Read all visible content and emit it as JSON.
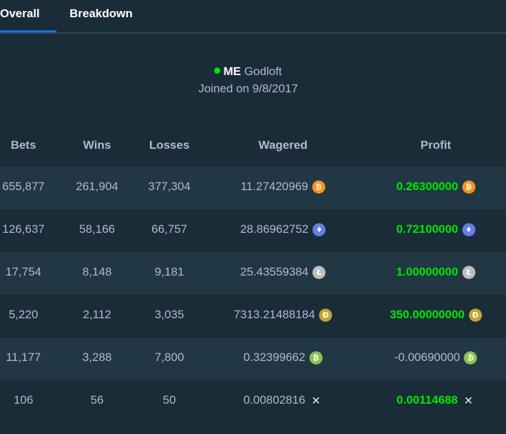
{
  "tabs": [
    {
      "label": "Overall",
      "active": true
    },
    {
      "label": "Breakdown",
      "active": false
    }
  ],
  "profile": {
    "status": "online",
    "rank": "ME",
    "username": "Godloft",
    "joined": "Joined on 9/8/2017"
  },
  "table": {
    "headers": {
      "bets": "Bets",
      "wins": "Wins",
      "losses": "Losses",
      "wagered": "Wagered",
      "profit": "Profit"
    },
    "rows": [
      {
        "bets": "655,877",
        "wins": "261,904",
        "losses": "377,304",
        "wagered": "11.27420969",
        "profit": "0.26300000",
        "profit_positive": true,
        "currency_icon": "bitcoin-icon",
        "icon_color": "#f7931a"
      },
      {
        "bets": "126,637",
        "wins": "58,166",
        "losses": "66,757",
        "wagered": "28.86962752",
        "profit": "0.72100000",
        "profit_positive": true,
        "currency_icon": "ethereum-icon",
        "icon_color": "#627eea"
      },
      {
        "bets": "17,754",
        "wins": "8,148",
        "losses": "9,181",
        "wagered": "25.43559384",
        "profit": "1.00000000",
        "profit_positive": true,
        "currency_icon": "litecoin-icon",
        "icon_color": "#bebebe"
      },
      {
        "bets": "5,220",
        "wins": "2,112",
        "losses": "3,035",
        "wagered": "7313.21488184",
        "profit": "350.00000000",
        "profit_positive": true,
        "currency_icon": "dogecoin-icon",
        "icon_color": "#c2a633"
      },
      {
        "bets": "11,177",
        "wins": "3,288",
        "losses": "7,800",
        "wagered": "0.32399662",
        "profit": "-0.00690000",
        "profit_positive": false,
        "currency_icon": "bitcoin-cash-icon",
        "icon_color": "#8dc351"
      },
      {
        "bets": "106",
        "wins": "56",
        "losses": "50",
        "wagered": "0.00802816",
        "profit": "0.00114688",
        "profit_positive": true,
        "currency_icon": "ripple-icon",
        "icon_color": "#e6e6e6"
      }
    ]
  },
  "colors": {
    "background": "#1a2c38",
    "row_alt": "#213743",
    "accent": "#1475e1",
    "positive": "#00e701",
    "text": "#b1bad3"
  }
}
